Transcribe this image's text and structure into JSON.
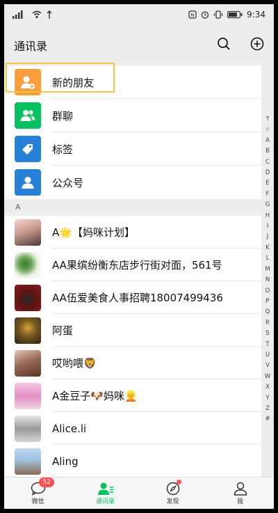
{
  "status": {
    "time": "9:34"
  },
  "header": {
    "title": "通讯录"
  },
  "features": [
    {
      "label": "新的朋友",
      "color": "#fa9d3b"
    },
    {
      "label": "群聊",
      "color": "#07c160"
    },
    {
      "label": "标签",
      "color": "#2782d7"
    },
    {
      "label": "公众号",
      "color": "#2782d7"
    }
  ],
  "section_letter": "A",
  "contacts": [
    {
      "name": "A🌟【妈咪计划】"
    },
    {
      "name": "AA果缤纷衡东店步行街对面，561号"
    },
    {
      "name": "AA伍爱美食人事招聘18007499436"
    },
    {
      "name": "阿蛋"
    },
    {
      "name": "哎哟喂🦁"
    },
    {
      "name": "A金豆子🐶妈咪👱"
    },
    {
      "name": "Alice.li"
    },
    {
      "name": "Aling"
    }
  ],
  "index_letters": [
    "↑",
    "☆",
    "A",
    "B",
    "C",
    "D",
    "E",
    "F",
    "G",
    "H",
    "I",
    "J",
    "K",
    "L",
    "M",
    "N",
    "O",
    "P",
    "Q",
    "R",
    "S",
    "T",
    "U",
    "V",
    "W",
    "X",
    "Y",
    "Z",
    "#"
  ],
  "tabs": [
    {
      "label": "微信",
      "badge": "52"
    },
    {
      "label": "通讯录"
    },
    {
      "label": "发现"
    },
    {
      "label": "我"
    }
  ],
  "colors": {
    "accent": "#07c160",
    "badge": "#fa5151",
    "highlight": "#f6c443"
  }
}
